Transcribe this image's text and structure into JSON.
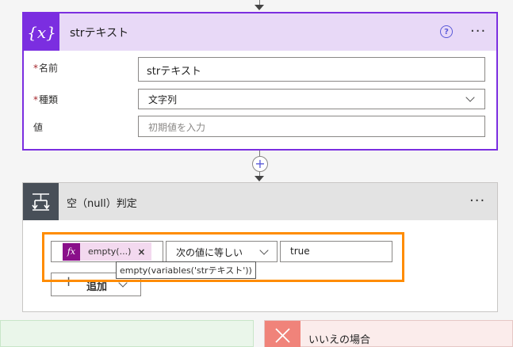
{
  "variable_action": {
    "icon_text": "{x}",
    "title": "strテキスト",
    "help_icon": "?",
    "more_icon": "···",
    "fields": {
      "name_label": "名前",
      "name_value": "strテキスト",
      "type_label": "種類",
      "type_value": "文字列",
      "value_label": "値",
      "value_placeholder": "初期値を入力"
    },
    "required_mark": "*"
  },
  "add_step_icon": "+",
  "condition_action": {
    "title": "空（null）判定",
    "more_icon": "···",
    "expression_token": {
      "fx_label": "fx",
      "label": "empty(...)",
      "remove": "×"
    },
    "operator": "次の値に等しい",
    "compare_value": "true",
    "tooltip": "empty(variables('strテキスト'))",
    "add_label": "追加"
  },
  "branches": {
    "no_label": "いいえの場合"
  },
  "colors": {
    "variable_accent": "#7b2ee0",
    "variable_header": "#e8d9f7",
    "condition_icon_bg": "#484f58",
    "highlight_box": "#ff8c00",
    "expression_fx": "#8a0f8a",
    "no_branch": "#f0837a"
  }
}
